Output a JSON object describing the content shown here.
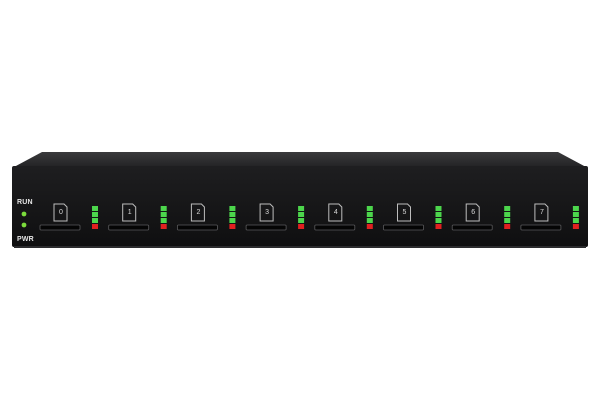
{
  "device": {
    "indicators": {
      "run_label": "RUN",
      "pwr_label": "PWR",
      "run_color": "#7cdc3c",
      "pwr_color": "#7cdc3c"
    },
    "slots": [
      {
        "number": "0"
      },
      {
        "number": "1"
      },
      {
        "number": "2"
      },
      {
        "number": "3"
      },
      {
        "number": "4"
      },
      {
        "number": "5"
      },
      {
        "number": "6"
      },
      {
        "number": "7"
      }
    ],
    "colors": {
      "chassis": "#1c1c1e",
      "led_green": "#4cd64c",
      "led_red": "#e02020",
      "slot_outline": "#bdbdbd"
    }
  }
}
